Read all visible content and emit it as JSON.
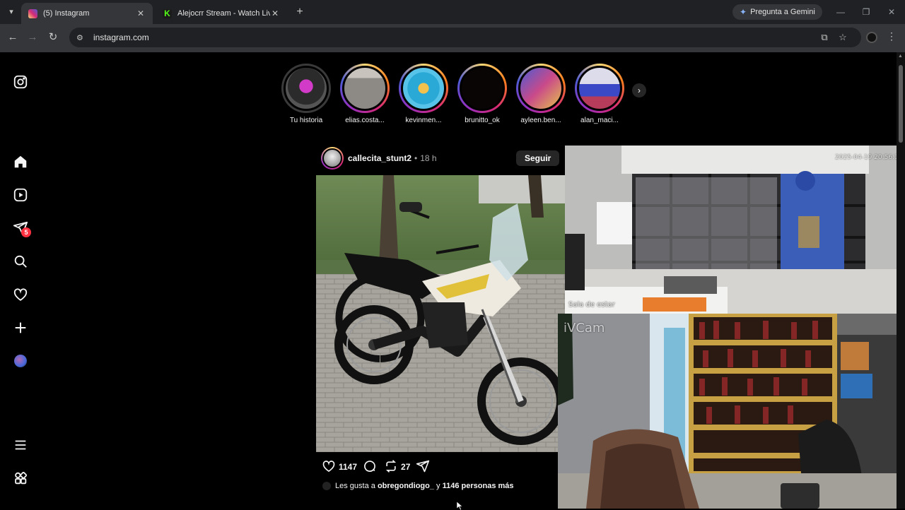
{
  "browser": {
    "tabs": [
      {
        "title": "(5) Instagram",
        "active": true
      },
      {
        "title": "Alejocrr Stream - Watch Live on",
        "active": false
      }
    ],
    "gemini_label": "Pregunta a Gemini",
    "url": "instagram.com"
  },
  "sidebar": {
    "items": [
      "instagram-logo",
      "home",
      "reels",
      "messages",
      "search",
      "notifications",
      "create",
      "profile",
      "more",
      "also-from-meta"
    ],
    "messages_badge": "5"
  },
  "stories": [
    {
      "name": "Tu historia"
    },
    {
      "name": "elias.costa..."
    },
    {
      "name": "kevinmen..."
    },
    {
      "name": "brunitto_ok"
    },
    {
      "name": "ayleen.ben..."
    },
    {
      "name": "alan_maci..."
    }
  ],
  "post": {
    "username": "callecita_stunt2",
    "separator": "•",
    "time": "18 h",
    "follow_label": "Seguir",
    "like_count": "1147",
    "repost_count": "27",
    "likes_text_prefix": "Les gusta a",
    "likes_user": "obregondiogo_",
    "likes_text_middle": "y",
    "likes_others": "1146 personas más"
  },
  "overlays": {
    "top_camera_label": "Sala de estar",
    "bottom_camera_label": "iVCam",
    "top_camera_timestamp": "2025-04-19 20:56:18"
  },
  "colors": {
    "accent": "#0095f6",
    "badge": "#ff3040",
    "background": "#000000"
  }
}
